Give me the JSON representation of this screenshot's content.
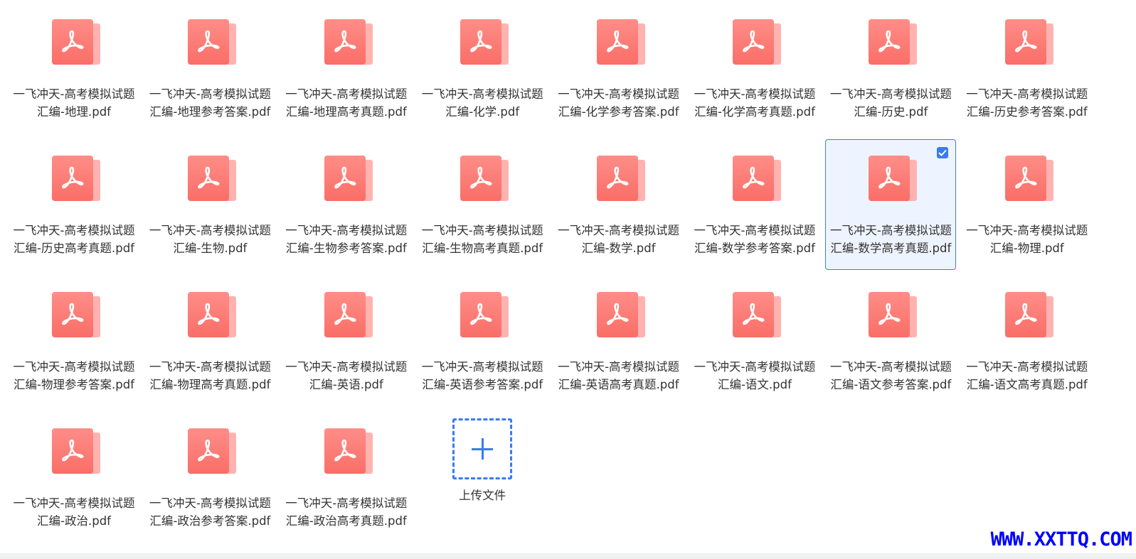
{
  "files": [
    {
      "name": "一飞冲天-高考模拟试题汇编-地理.pdf",
      "selected": false
    },
    {
      "name": "一飞冲天-高考模拟试题汇编-地理参考答案.pdf",
      "selected": false
    },
    {
      "name": "一飞冲天-高考模拟试题汇编-地理高考真题.pdf",
      "selected": false
    },
    {
      "name": "一飞冲天-高考模拟试题汇编-化学.pdf",
      "selected": false
    },
    {
      "name": "一飞冲天-高考模拟试题汇编-化学参考答案.pdf",
      "selected": false
    },
    {
      "name": "一飞冲天-高考模拟试题汇编-化学高考真题.pdf",
      "selected": false
    },
    {
      "name": "一飞冲天-高考模拟试题汇编-历史.pdf",
      "selected": false
    },
    {
      "name": "一飞冲天-高考模拟试题汇编-历史参考答案.pdf",
      "selected": false
    },
    {
      "name": "一飞冲天-高考模拟试题汇编-历史高考真题.pdf",
      "selected": false
    },
    {
      "name": "一飞冲天-高考模拟试题汇编-生物.pdf",
      "selected": false
    },
    {
      "name": "一飞冲天-高考模拟试题汇编-生物参考答案.pdf",
      "selected": false
    },
    {
      "name": "一飞冲天-高考模拟试题汇编-生物高考真题.pdf",
      "selected": false
    },
    {
      "name": "一飞冲天-高考模拟试题汇编-数学.pdf",
      "selected": false
    },
    {
      "name": "一飞冲天-高考模拟试题汇编-数学参考答案.pdf",
      "selected": false
    },
    {
      "name": "一飞冲天-高考模拟试题汇编-数学高考真题.pdf",
      "selected": true
    },
    {
      "name": "一飞冲天-高考模拟试题汇编-物理.pdf",
      "selected": false
    },
    {
      "name": "一飞冲天-高考模拟试题汇编-物理参考答案.pdf",
      "selected": false
    },
    {
      "name": "一飞冲天-高考模拟试题汇编-物理高考真题.pdf",
      "selected": false
    },
    {
      "name": "一飞冲天-高考模拟试题汇编-英语.pdf",
      "selected": false
    },
    {
      "name": "一飞冲天-高考模拟试题汇编-英语参考答案.pdf",
      "selected": false
    },
    {
      "name": "一飞冲天-高考模拟试题汇编-英语高考真题.pdf",
      "selected": false
    },
    {
      "name": "一飞冲天-高考模拟试题汇编-语文.pdf",
      "selected": false
    },
    {
      "name": "一飞冲天-高考模拟试题汇编-语文参考答案.pdf",
      "selected": false
    },
    {
      "name": "一飞冲天-高考模拟试题汇编-语文高考真题.pdf",
      "selected": false
    },
    {
      "name": "一飞冲天-高考模拟试题汇编-政治.pdf",
      "selected": false
    },
    {
      "name": "一飞冲天-高考模拟试题汇编-政治参考答案.pdf",
      "selected": false
    },
    {
      "name": "一飞冲天-高考模拟试题汇编-政治高考真题.pdf",
      "selected": false
    }
  ],
  "upload": {
    "label": "上传文件"
  },
  "watermark": "WWW.XXTTQ.COM",
  "icons": {
    "file": "pdf-file-icon",
    "upload": "plus-icon",
    "selected": "checkbox-checked-icon"
  },
  "colors": {
    "accent": "#3a7bf0",
    "pdf": "#fa6e67",
    "selected_bg": "#eef4ff",
    "watermark": "#0000ff"
  }
}
